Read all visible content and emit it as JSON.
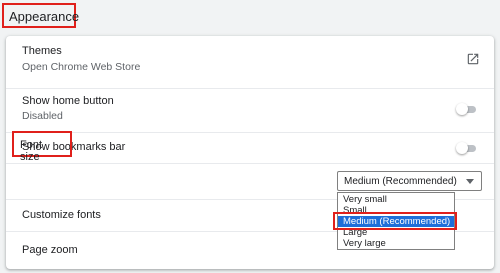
{
  "section": {
    "title": "Appearance"
  },
  "themes": {
    "label": "Themes",
    "sublabel": "Open Chrome Web Store",
    "icon": "open-in-new-icon"
  },
  "home_button": {
    "label": "Show home button",
    "sublabel": "Disabled",
    "enabled": false
  },
  "bookmarks_bar": {
    "label": "Show bookmarks bar",
    "enabled": false
  },
  "font_size": {
    "label": "Font size",
    "selected": "Medium (Recommended)",
    "options": [
      "Very small",
      "Small",
      "Medium (Recommended)",
      "Large",
      "Very large"
    ]
  },
  "customize_fonts": {
    "label": "Customize fonts"
  },
  "page_zoom": {
    "label": "Page zoom"
  },
  "colors": {
    "highlight": "#e0201b",
    "selected_option": "#1e6fd9"
  }
}
